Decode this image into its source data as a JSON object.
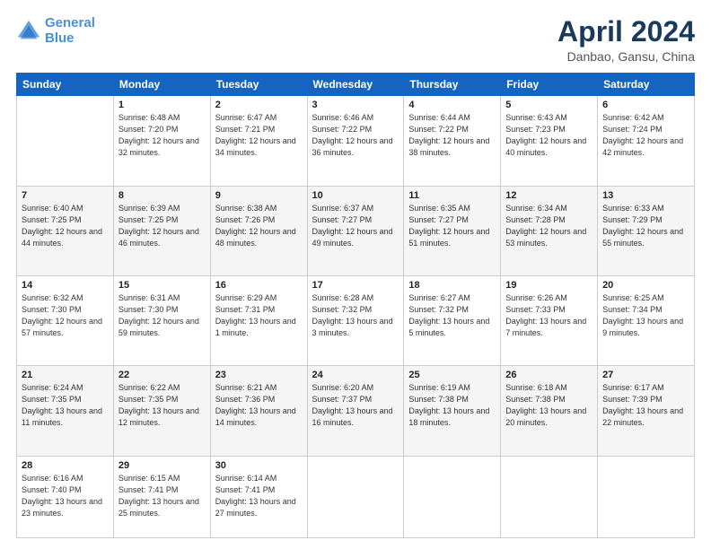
{
  "header": {
    "logo_line1": "General",
    "logo_line2": "Blue",
    "title": "April 2024",
    "subtitle": "Danbao, Gansu, China"
  },
  "weekdays": [
    "Sunday",
    "Monday",
    "Tuesday",
    "Wednesday",
    "Thursday",
    "Friday",
    "Saturday"
  ],
  "weeks": [
    [
      {
        "day": "",
        "sunrise": "",
        "sunset": "",
        "daylight": ""
      },
      {
        "day": "1",
        "sunrise": "Sunrise: 6:48 AM",
        "sunset": "Sunset: 7:20 PM",
        "daylight": "Daylight: 12 hours and 32 minutes."
      },
      {
        "day": "2",
        "sunrise": "Sunrise: 6:47 AM",
        "sunset": "Sunset: 7:21 PM",
        "daylight": "Daylight: 12 hours and 34 minutes."
      },
      {
        "day": "3",
        "sunrise": "Sunrise: 6:46 AM",
        "sunset": "Sunset: 7:22 PM",
        "daylight": "Daylight: 12 hours and 36 minutes."
      },
      {
        "day": "4",
        "sunrise": "Sunrise: 6:44 AM",
        "sunset": "Sunset: 7:22 PM",
        "daylight": "Daylight: 12 hours and 38 minutes."
      },
      {
        "day": "5",
        "sunrise": "Sunrise: 6:43 AM",
        "sunset": "Sunset: 7:23 PM",
        "daylight": "Daylight: 12 hours and 40 minutes."
      },
      {
        "day": "6",
        "sunrise": "Sunrise: 6:42 AM",
        "sunset": "Sunset: 7:24 PM",
        "daylight": "Daylight: 12 hours and 42 minutes."
      }
    ],
    [
      {
        "day": "7",
        "sunrise": "Sunrise: 6:40 AM",
        "sunset": "Sunset: 7:25 PM",
        "daylight": "Daylight: 12 hours and 44 minutes."
      },
      {
        "day": "8",
        "sunrise": "Sunrise: 6:39 AM",
        "sunset": "Sunset: 7:25 PM",
        "daylight": "Daylight: 12 hours and 46 minutes."
      },
      {
        "day": "9",
        "sunrise": "Sunrise: 6:38 AM",
        "sunset": "Sunset: 7:26 PM",
        "daylight": "Daylight: 12 hours and 48 minutes."
      },
      {
        "day": "10",
        "sunrise": "Sunrise: 6:37 AM",
        "sunset": "Sunset: 7:27 PM",
        "daylight": "Daylight: 12 hours and 49 minutes."
      },
      {
        "day": "11",
        "sunrise": "Sunrise: 6:35 AM",
        "sunset": "Sunset: 7:27 PM",
        "daylight": "Daylight: 12 hours and 51 minutes."
      },
      {
        "day": "12",
        "sunrise": "Sunrise: 6:34 AM",
        "sunset": "Sunset: 7:28 PM",
        "daylight": "Daylight: 12 hours and 53 minutes."
      },
      {
        "day": "13",
        "sunrise": "Sunrise: 6:33 AM",
        "sunset": "Sunset: 7:29 PM",
        "daylight": "Daylight: 12 hours and 55 minutes."
      }
    ],
    [
      {
        "day": "14",
        "sunrise": "Sunrise: 6:32 AM",
        "sunset": "Sunset: 7:30 PM",
        "daylight": "Daylight: 12 hours and 57 minutes."
      },
      {
        "day": "15",
        "sunrise": "Sunrise: 6:31 AM",
        "sunset": "Sunset: 7:30 PM",
        "daylight": "Daylight: 12 hours and 59 minutes."
      },
      {
        "day": "16",
        "sunrise": "Sunrise: 6:29 AM",
        "sunset": "Sunset: 7:31 PM",
        "daylight": "Daylight: 13 hours and 1 minute."
      },
      {
        "day": "17",
        "sunrise": "Sunrise: 6:28 AM",
        "sunset": "Sunset: 7:32 PM",
        "daylight": "Daylight: 13 hours and 3 minutes."
      },
      {
        "day": "18",
        "sunrise": "Sunrise: 6:27 AM",
        "sunset": "Sunset: 7:32 PM",
        "daylight": "Daylight: 13 hours and 5 minutes."
      },
      {
        "day": "19",
        "sunrise": "Sunrise: 6:26 AM",
        "sunset": "Sunset: 7:33 PM",
        "daylight": "Daylight: 13 hours and 7 minutes."
      },
      {
        "day": "20",
        "sunrise": "Sunrise: 6:25 AM",
        "sunset": "Sunset: 7:34 PM",
        "daylight": "Daylight: 13 hours and 9 minutes."
      }
    ],
    [
      {
        "day": "21",
        "sunrise": "Sunrise: 6:24 AM",
        "sunset": "Sunset: 7:35 PM",
        "daylight": "Daylight: 13 hours and 11 minutes."
      },
      {
        "day": "22",
        "sunrise": "Sunrise: 6:22 AM",
        "sunset": "Sunset: 7:35 PM",
        "daylight": "Daylight: 13 hours and 12 minutes."
      },
      {
        "day": "23",
        "sunrise": "Sunrise: 6:21 AM",
        "sunset": "Sunset: 7:36 PM",
        "daylight": "Daylight: 13 hours and 14 minutes."
      },
      {
        "day": "24",
        "sunrise": "Sunrise: 6:20 AM",
        "sunset": "Sunset: 7:37 PM",
        "daylight": "Daylight: 13 hours and 16 minutes."
      },
      {
        "day": "25",
        "sunrise": "Sunrise: 6:19 AM",
        "sunset": "Sunset: 7:38 PM",
        "daylight": "Daylight: 13 hours and 18 minutes."
      },
      {
        "day": "26",
        "sunrise": "Sunrise: 6:18 AM",
        "sunset": "Sunset: 7:38 PM",
        "daylight": "Daylight: 13 hours and 20 minutes."
      },
      {
        "day": "27",
        "sunrise": "Sunrise: 6:17 AM",
        "sunset": "Sunset: 7:39 PM",
        "daylight": "Daylight: 13 hours and 22 minutes."
      }
    ],
    [
      {
        "day": "28",
        "sunrise": "Sunrise: 6:16 AM",
        "sunset": "Sunset: 7:40 PM",
        "daylight": "Daylight: 13 hours and 23 minutes."
      },
      {
        "day": "29",
        "sunrise": "Sunrise: 6:15 AM",
        "sunset": "Sunset: 7:41 PM",
        "daylight": "Daylight: 13 hours and 25 minutes."
      },
      {
        "day": "30",
        "sunrise": "Sunrise: 6:14 AM",
        "sunset": "Sunset: 7:41 PM",
        "daylight": "Daylight: 13 hours and 27 minutes."
      },
      {
        "day": "",
        "sunrise": "",
        "sunset": "",
        "daylight": ""
      },
      {
        "day": "",
        "sunrise": "",
        "sunset": "",
        "daylight": ""
      },
      {
        "day": "",
        "sunrise": "",
        "sunset": "",
        "daylight": ""
      },
      {
        "day": "",
        "sunrise": "",
        "sunset": "",
        "daylight": ""
      }
    ]
  ]
}
